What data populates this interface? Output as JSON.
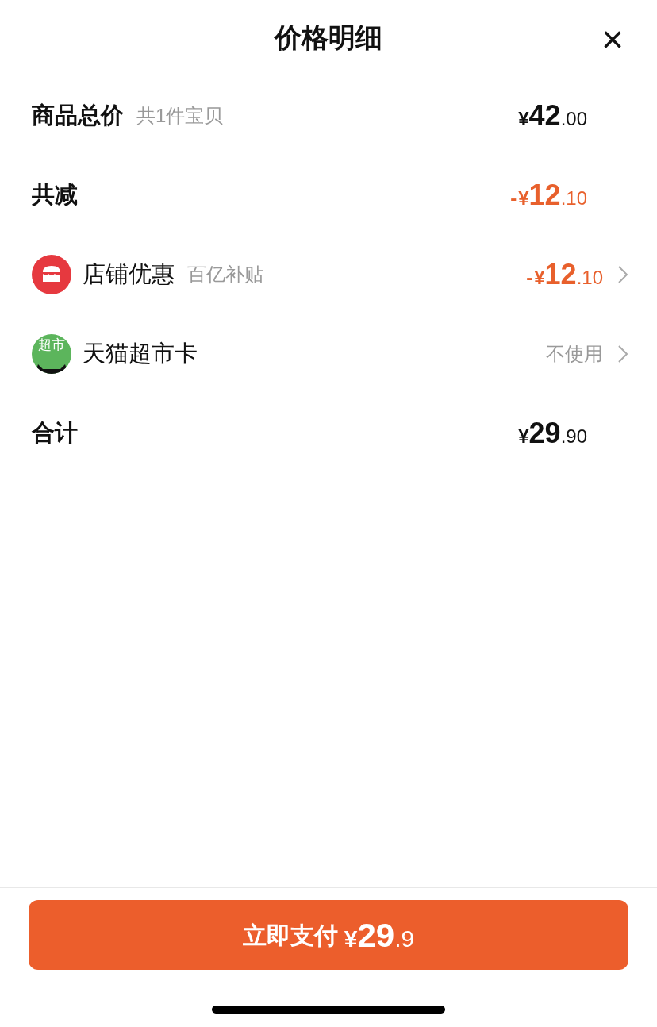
{
  "header": {
    "title": "价格明细",
    "close": "×"
  },
  "rows": [
    {
      "kind": "plain",
      "label": "商品总价",
      "note": "共1件宝贝",
      "price": {
        "currency": "¥",
        "int": "42",
        "dec": ".00"
      },
      "discount": false,
      "chevron": false
    },
    {
      "kind": "plain",
      "label": "共减",
      "price": {
        "sign": "-",
        "currency": "¥",
        "int": "12",
        "dec": ".10"
      },
      "discount": true,
      "chevron": false
    },
    {
      "kind": "store",
      "label": "店铺优惠",
      "note": "百亿补贴",
      "price": {
        "sign": "-",
        "currency": "¥",
        "int": "12",
        "dec": ".10"
      },
      "discount": true,
      "chevron": true
    },
    {
      "kind": "card",
      "label": "天猫超市卡",
      "icon_text": "超市",
      "value": "不使用",
      "discount": false,
      "chevron": true
    },
    {
      "kind": "plain",
      "label": "合计",
      "price": {
        "currency": "¥",
        "int": "29",
        "dec": ".90"
      },
      "discount": false,
      "chevron": false
    }
  ],
  "pay_button": {
    "label": "立即支付",
    "price": {
      "currency": "¥",
      "int": "29",
      "dec": ".9"
    }
  }
}
